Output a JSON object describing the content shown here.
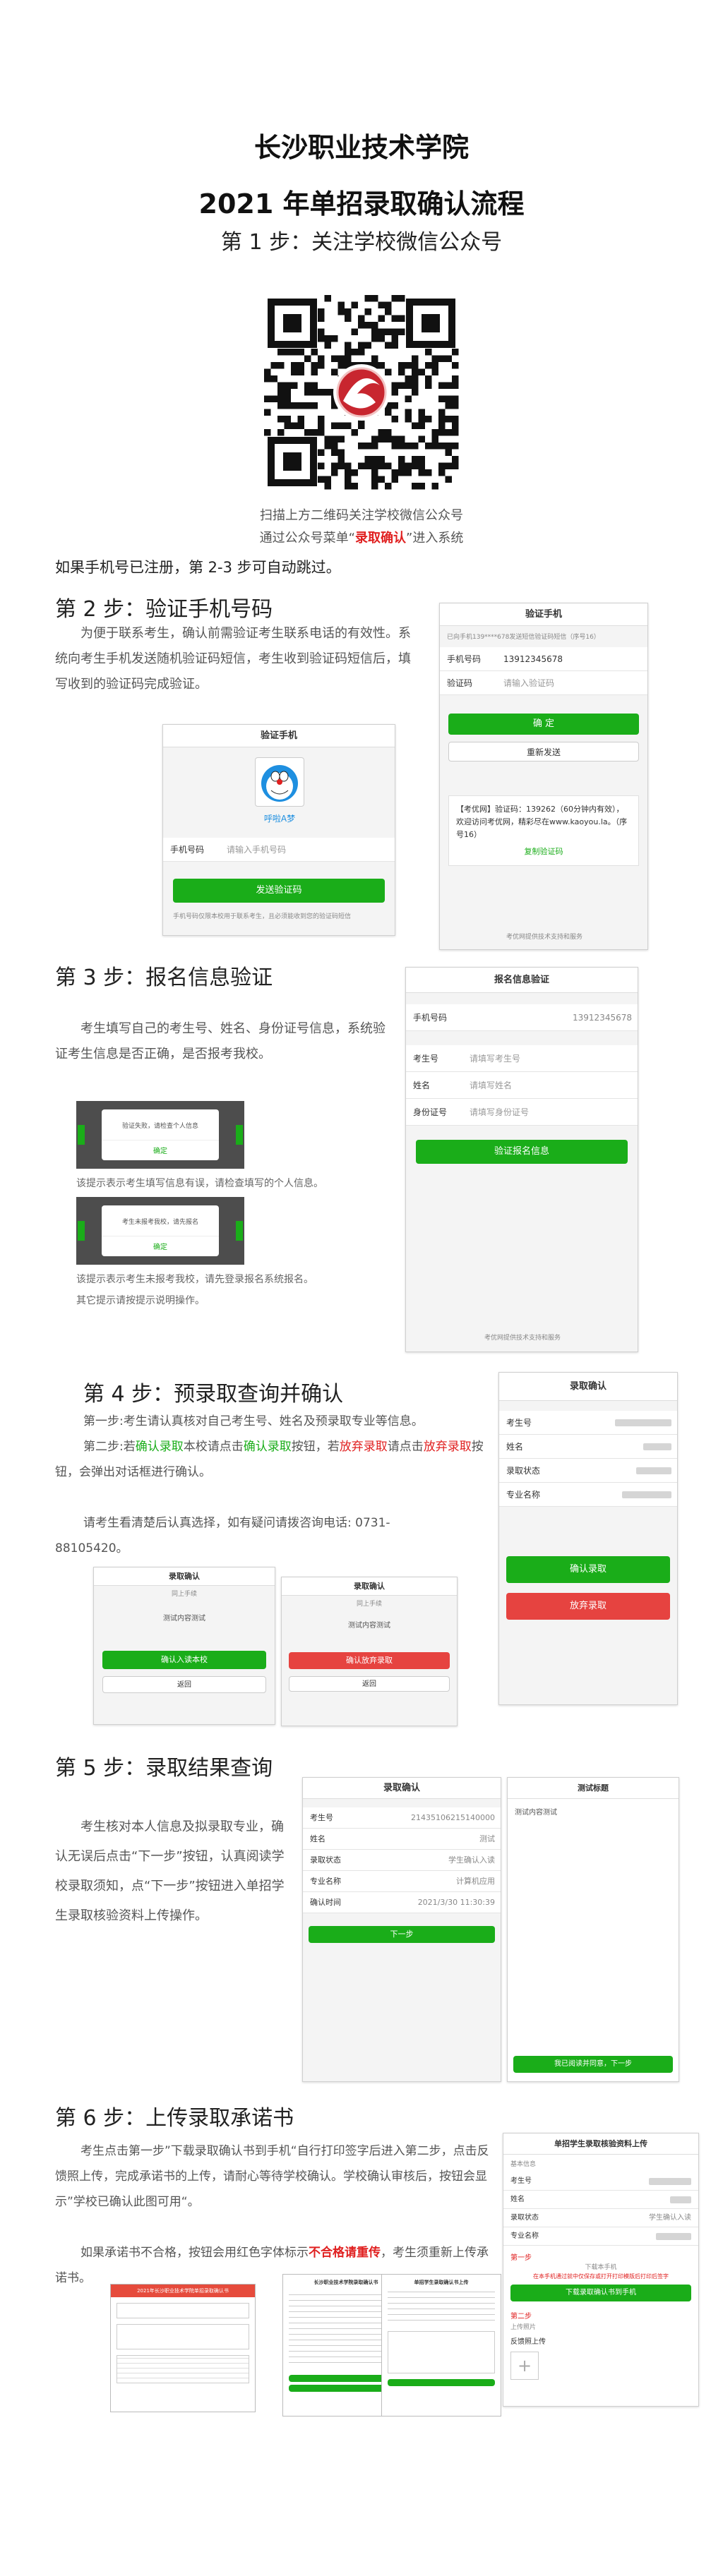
{
  "header": {
    "school": "长沙职业技术学院",
    "title": "2021 年单招录取确认流程",
    "step1": "第 1 步：关注学校微信公众号"
  },
  "qr": {
    "caption1": "扫描上方二维码关注学校微信公众号",
    "caption2_pre": "通过公众号菜单“",
    "caption2_hl": "录取确认",
    "caption2_post": "”进入系统",
    "note": "如果手机号已注册，第 2-3 步可自动跳过。"
  },
  "step2": {
    "heading": "第 2 步：验证手机号码",
    "text": "为便于联系考生，确认前需验证考生联系电话的有效性。系统向考生手机发送随机验证码短信，考生收到验证码短信后，填写收到的验证码完成验证。",
    "shotA": {
      "title": "验证手机",
      "nickname": "呼啦A梦",
      "phone_label": "手机号码",
      "phone_placeholder": "请输入手机号码",
      "send_btn": "发送验证码",
      "tip": "手机号码仅限本校用于联系考生，且必须能收到您的验证码短信"
    },
    "shotB": {
      "title": "验证手机",
      "sent_tip": "已向手机139****678发送短信验证码短信（序号16）",
      "phone_label": "手机号码",
      "phone_value": "13912345678",
      "code_label": "验证码",
      "code_placeholder": "请输入验证码",
      "confirm_btn": "确 定",
      "resend_btn": "重新发送",
      "sms": "【考优网】验证码：139262（60分钟内有效），欢迎访问考优网，精彩尽在www.kaoyou.la。（序号16）",
      "copy_btn": "复制验证码",
      "footer": "考优网提供技术支持和服务"
    }
  },
  "step3": {
    "heading": "第 3 步：报名信息验证",
    "text": "考生填写自己的考生号、姓名、身份证号信息，系统验证考生信息是否正确，是否报考我校。",
    "dialog1_text": "验证失败，请检查个人信息",
    "dialog1_btn": "确定",
    "caption1": "该提示表示考生填写信息有误，请检查填写的个人信息。",
    "dialog2_text": "考生未报考我校，请先报名",
    "dialog2_btn": "确定",
    "caption2": "该提示表示考生未报考我校，请先登录报名系统报名。",
    "caption3": "其它提示请按提示说明操作。",
    "form": {
      "title": "报名信息验证",
      "phone_label": "手机号码",
      "phone_value": "13912345678",
      "ksh_label": "考生号",
      "ksh_placeholder": "请填写考生号",
      "name_label": "姓名",
      "name_placeholder": "请填写姓名",
      "id_label": "身份证号",
      "id_placeholder": "请填写身份证号",
      "submit_btn": "验证报名信息",
      "footer": "考优网提供技术支持和服务"
    }
  },
  "step4": {
    "heading": "第 4 步：预录取查询并确认",
    "line1": "第一步:考生请认真核对自己考生号、姓名及预录取专业等信息。",
    "line2_a": "第二步:若",
    "line2_b": "确认录取",
    "line2_c": "本校请点击",
    "line2_d": "确认录取",
    "line2_e": "按钮，若",
    "line2_f": "放弃录取",
    "line2_g": "请点击",
    "line2_h": "放弃录取",
    "line2_i": "按钮，会弹出对话框进行确认。",
    "line3": "请考生看清楚后认真选择，如有疑问请拨咨询电话: 0731-88105420。",
    "dlgA": {
      "title": "录取确认",
      "sub": "同上手续",
      "text": "测试内容测试",
      "ok": "确认入读本校",
      "back": "返回"
    },
    "dlgB": {
      "title": "录取确认",
      "sub": "同上手续",
      "text": "测试内容测试",
      "ok": "确认放弃录取",
      "back": "返回"
    },
    "shot": {
      "title": "录取确认",
      "labels": [
        "考生号",
        "姓名",
        "录取状态",
        "专业名称"
      ],
      "confirm_btn": "确认录取",
      "abandon_btn": "放弃录取"
    }
  },
  "step5": {
    "heading": "第 5 步：录取结果查询",
    "text": "考生核对本人信息及拟录取专业，确认无误后点击“下一步”按钮，认真阅读学校录取须知，点“下一步”按钮进入单招学生录取核验资料上传操作。",
    "shotA": {
      "title": "录取确认",
      "rows": [
        {
          "label": "考生号",
          "value": "21435106215140000"
        },
        {
          "label": "姓名",
          "value": "测试"
        },
        {
          "label": "录取状态",
          "value": "学生确认入读"
        },
        {
          "label": "专业名称",
          "value": "计算机应用"
        },
        {
          "label": "确认时间",
          "value": "2021/3/30 11:30:39"
        }
      ],
      "next_btn": "下一步"
    },
    "shotB": {
      "title": "测试标题",
      "body": "测试内容测试",
      "btn": "我已阅读并同意，下一步"
    }
  },
  "step6": {
    "heading": "第 6 步：上传录取承诺书",
    "text1": "考生点击第一步”下载录取确认书到手机“自行打印签字后进入第二步，点击反馈照上传，完成承诺书的上传，请耐心等待学校确认。学校确认审核后，按钮会显示”学校已确认此图可用“。",
    "text2_a": "如果承诺书不合格，按钮会用红色字体标示",
    "text2_b": "不合格请重传",
    "text2_c": "，考生须重新上传承诺书。",
    "shot": {
      "title": "单招学生录取核验资料上传",
      "sub": "基本信息",
      "labels": [
        "考生号",
        "姓名",
        "录取状态",
        "专业名称"
      ],
      "status": "学生确认入读",
      "first": "第一步",
      "download_tip": "下载本手机",
      "warn": "在本手机通过就中仅保存或打开打印模版后打印后签字",
      "download_btn": "下载录取确认书到手机",
      "second": "第二步",
      "second_tip": "上传照片",
      "feedback": "反馈照上传"
    },
    "docA_title": "2021年长沙职业技术学院单招录取确认书",
    "docB_title": "长沙职业技术学院录取确认书",
    "docC_title": "单招学生录取确认书上传"
  }
}
